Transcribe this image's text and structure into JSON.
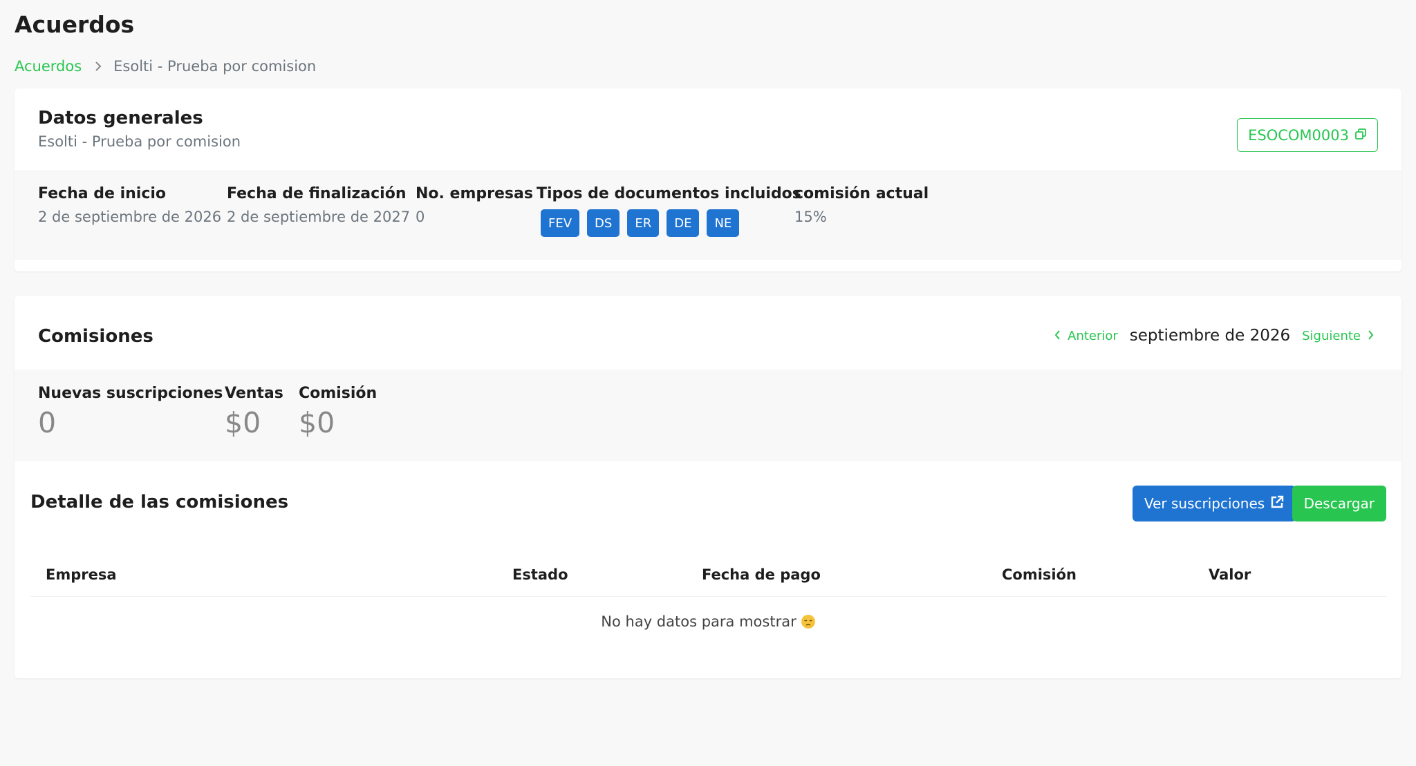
{
  "page": {
    "title": "Acuerdos",
    "breadcrumb": {
      "root": "Acuerdos",
      "current": "Esolti - Prueba por comision"
    }
  },
  "general": {
    "title": "Datos generales",
    "subtitle": "Esolti - Prueba por comision",
    "code": "ESOCOM0003",
    "fields": {
      "start_label": "Fecha de inicio",
      "start_value": "2 de septiembre de 2026",
      "end_label": "Fecha de finalización",
      "end_value": "2 de septiembre de 2027",
      "companies_label": "No. empresas",
      "companies_value": "0",
      "doc_types_label": "Tipos de documentos incluidos",
      "doc_types": [
        "FEV",
        "DS",
        "ER",
        "DE",
        "NE"
      ],
      "commission_label": "comisión actual",
      "commission_value": "15%"
    }
  },
  "commissions": {
    "title": "Comisiones",
    "nav": {
      "prev": "Anterior",
      "month": "septiembre de 2026",
      "next": "Siguiente"
    },
    "stats": {
      "new_subs_label": "Nuevas suscripciones",
      "new_subs_value": "0",
      "sales_label": "Ventas",
      "sales_value": "$0",
      "commission_label": "Comisión",
      "commission_value": "$0"
    },
    "detail": {
      "title": "Detalle de las comisiones",
      "view_button": "Ver suscripciones",
      "download_button": "Descargar",
      "columns": [
        "Empresa",
        "Estado",
        "Fecha de pago",
        "Comisión",
        "Valor"
      ],
      "empty_message": "No hay datos para mostrar"
    }
  },
  "colors": {
    "accent_green": "#28c650",
    "accent_blue": "#1f74d2"
  }
}
